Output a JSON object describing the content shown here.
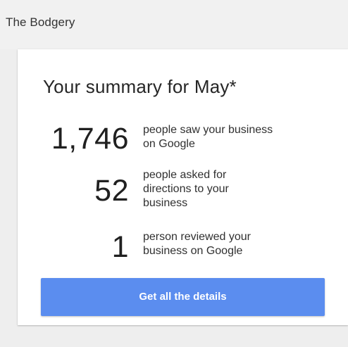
{
  "header": {
    "business_name": "The Bodgery"
  },
  "summary": {
    "title": "Your summary for May*",
    "stats": [
      {
        "number": "1,746",
        "text_lines": [
          "people saw your business",
          "on Google"
        ]
      },
      {
        "number": "52",
        "text_lines": [
          "people asked for",
          "directions to your",
          "business"
        ]
      },
      {
        "number": "1",
        "text_lines": [
          "person reviewed your",
          "business on Google"
        ]
      }
    ],
    "button_label": "Get all the details"
  },
  "colors": {
    "button": "#5b8def",
    "background": "#eeeeee",
    "card": "#ffffff"
  }
}
